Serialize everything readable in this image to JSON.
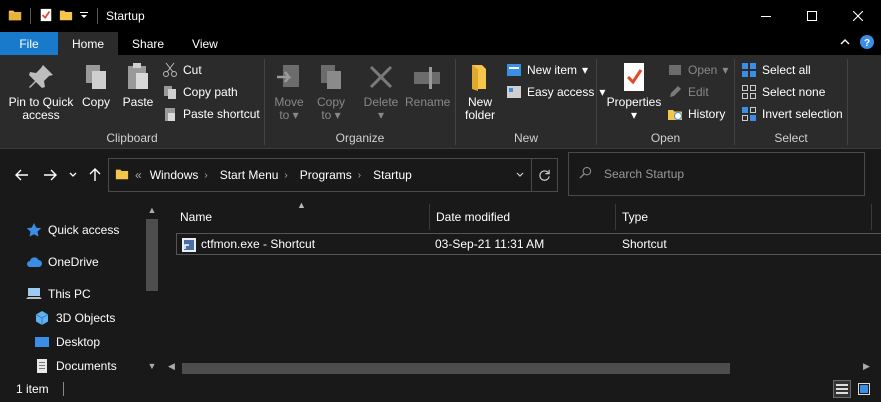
{
  "window": {
    "title": "Startup"
  },
  "tabs": [
    {
      "label": "File"
    },
    {
      "label": "Home"
    },
    {
      "label": "Share"
    },
    {
      "label": "View"
    }
  ],
  "ribbon": {
    "clipboard": {
      "label": "Clipboard",
      "pin": "Pin to Quick access",
      "pin_line1": "Pin to Quick",
      "pin_line2": "access",
      "copy": "Copy",
      "paste": "Paste",
      "cut": "Cut",
      "copy_path": "Copy path",
      "paste_shortcut": "Paste shortcut"
    },
    "organize": {
      "label": "Organize",
      "move_to_1": "Move",
      "move_to_2": "to",
      "copy_to_1": "Copy",
      "copy_to_2": "to",
      "delete": "Delete",
      "rename": "Rename"
    },
    "new": {
      "label": "New",
      "new_folder_1": "New",
      "new_folder_2": "folder",
      "new_item": "New item",
      "easy_access": "Easy access"
    },
    "open": {
      "label": "Open",
      "properties": "Properties",
      "open": "Open",
      "edit": "Edit",
      "history": "History"
    },
    "select": {
      "label": "Select",
      "select_all": "Select all",
      "select_none": "Select none",
      "invert": "Invert selection"
    }
  },
  "address": {
    "overflow": "«",
    "crumbs": [
      "Windows",
      "Start Menu",
      "Programs",
      "Startup"
    ]
  },
  "search": {
    "placeholder": "Search Startup"
  },
  "navpane": {
    "items": [
      {
        "label": "Quick access"
      },
      {
        "label": "OneDrive"
      },
      {
        "label": "This PC"
      },
      {
        "label": "3D Objects"
      },
      {
        "label": "Desktop"
      },
      {
        "label": "Documents"
      }
    ]
  },
  "filelist": {
    "columns": [
      "Name",
      "Date modified",
      "Type"
    ],
    "rows": [
      {
        "name": "ctfmon.exe - Shortcut",
        "date": "03-Sep-21 11:31 AM",
        "type": "Shortcut"
      }
    ]
  },
  "status": {
    "count": "1 item"
  },
  "colors": {
    "file_tab": "#1979ca",
    "folder": "#f5c64b",
    "accent_blue": "#3a8ee6"
  }
}
